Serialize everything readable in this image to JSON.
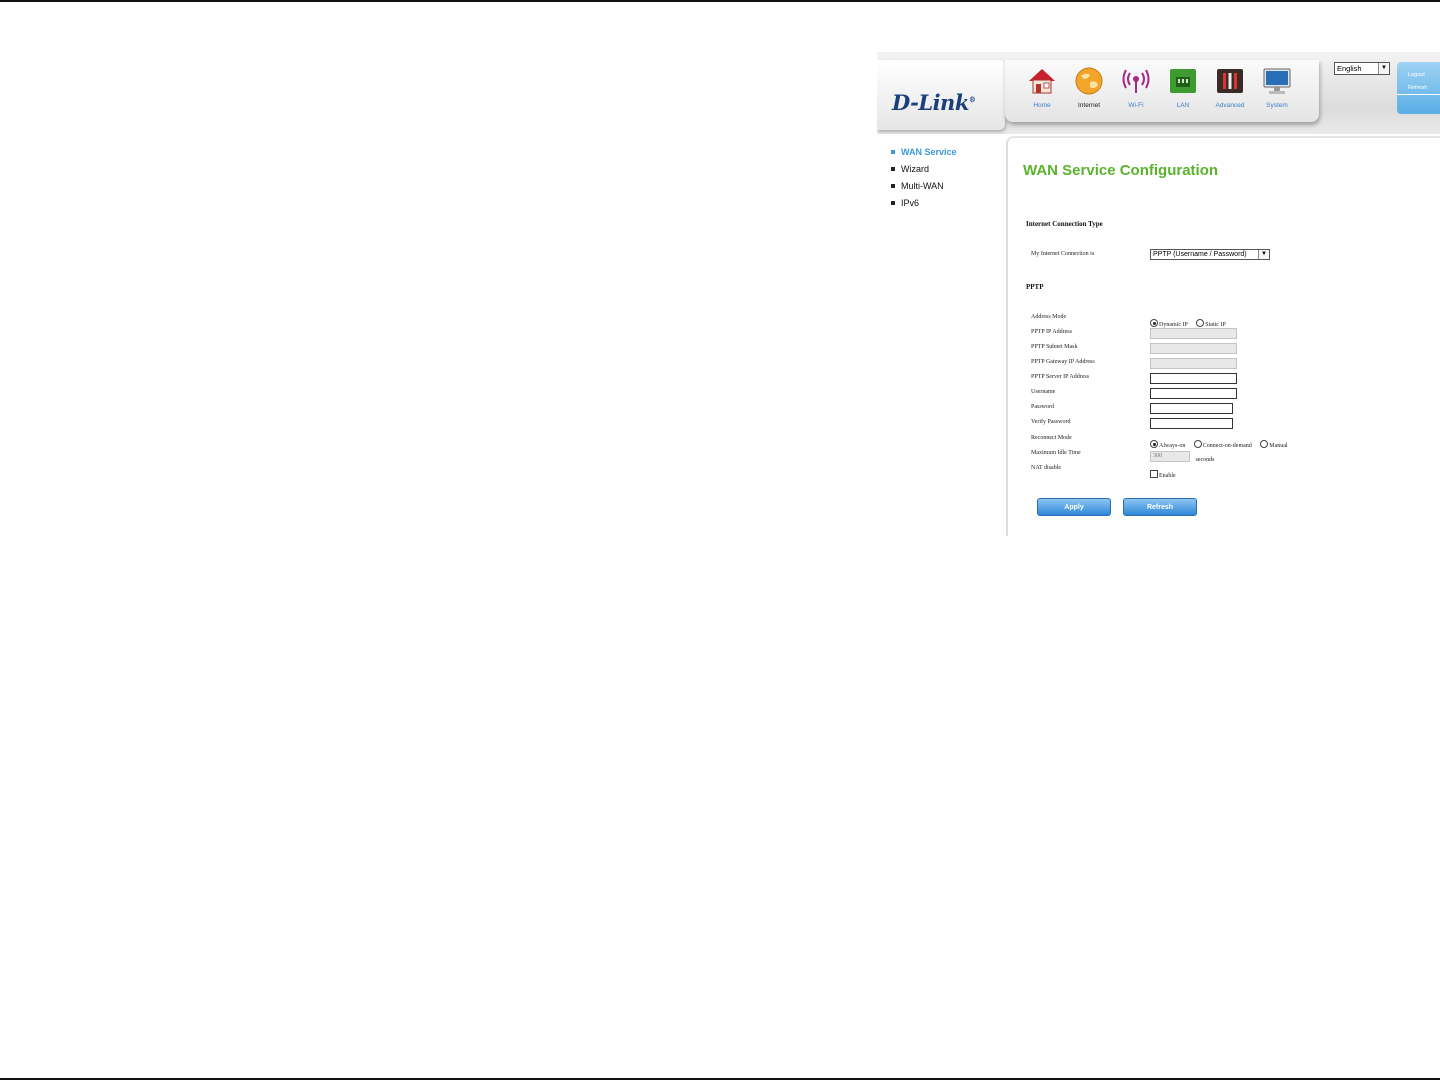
{
  "header": {
    "logo_text": "D-Link",
    "logo_mark": "®",
    "language": "English",
    "side_links": {
      "logout": "Logout",
      "refresh": "Refresh"
    },
    "nav": [
      {
        "label": "Home",
        "icon": "home-icon"
      },
      {
        "label": "Internet",
        "icon": "globe-icon"
      },
      {
        "label": "Wi-Fi",
        "icon": "wifi-icon"
      },
      {
        "label": "LAN",
        "icon": "lan-icon"
      },
      {
        "label": "Advanced",
        "icon": "tools-icon"
      },
      {
        "label": "System",
        "icon": "monitor-icon"
      }
    ],
    "active_nav": "Internet"
  },
  "menu": {
    "items": [
      "WAN Service",
      "Wizard",
      "Multi-WAN",
      "IPv6"
    ],
    "active": "WAN Service"
  },
  "main": {
    "title": "WAN Service Configuration",
    "section_connection": "Internet Connection Type",
    "connection_label": "My Internet Connection is",
    "connection_value": "PPTP (Username / Password)",
    "section_pptp": "PPTP",
    "fields": {
      "address_mode": "Address Mode",
      "address_mode_options": [
        "Dynamic IP",
        "Static IP"
      ],
      "pptp_ip": "PPTP IP Address",
      "pptp_mask": "PPTP Subnet Mask",
      "pptp_gateway": "PPTP Gateway IP Address",
      "pptp_server": "PPTP Server IP Address",
      "username": "Username",
      "password": "Password",
      "verify_password": "Verify Password",
      "reconnect_mode": "Reconnect Mode",
      "reconnect_options": [
        "Always-on",
        "Connect-on-demand",
        "Manual"
      ],
      "max_idle": "Maximum Idle Time",
      "max_idle_value": "300",
      "max_idle_unit": "seconds",
      "nat_disable": "NAT disable",
      "nat_enable_label": "Enable"
    },
    "buttons": {
      "apply": "Apply",
      "refresh": "Refresh"
    }
  },
  "colors": {
    "title_green": "#5ab32c",
    "link_blue": "#3c9ad8",
    "button_blue": "#2f87d8",
    "logo_navy": "#1b3f7a"
  }
}
